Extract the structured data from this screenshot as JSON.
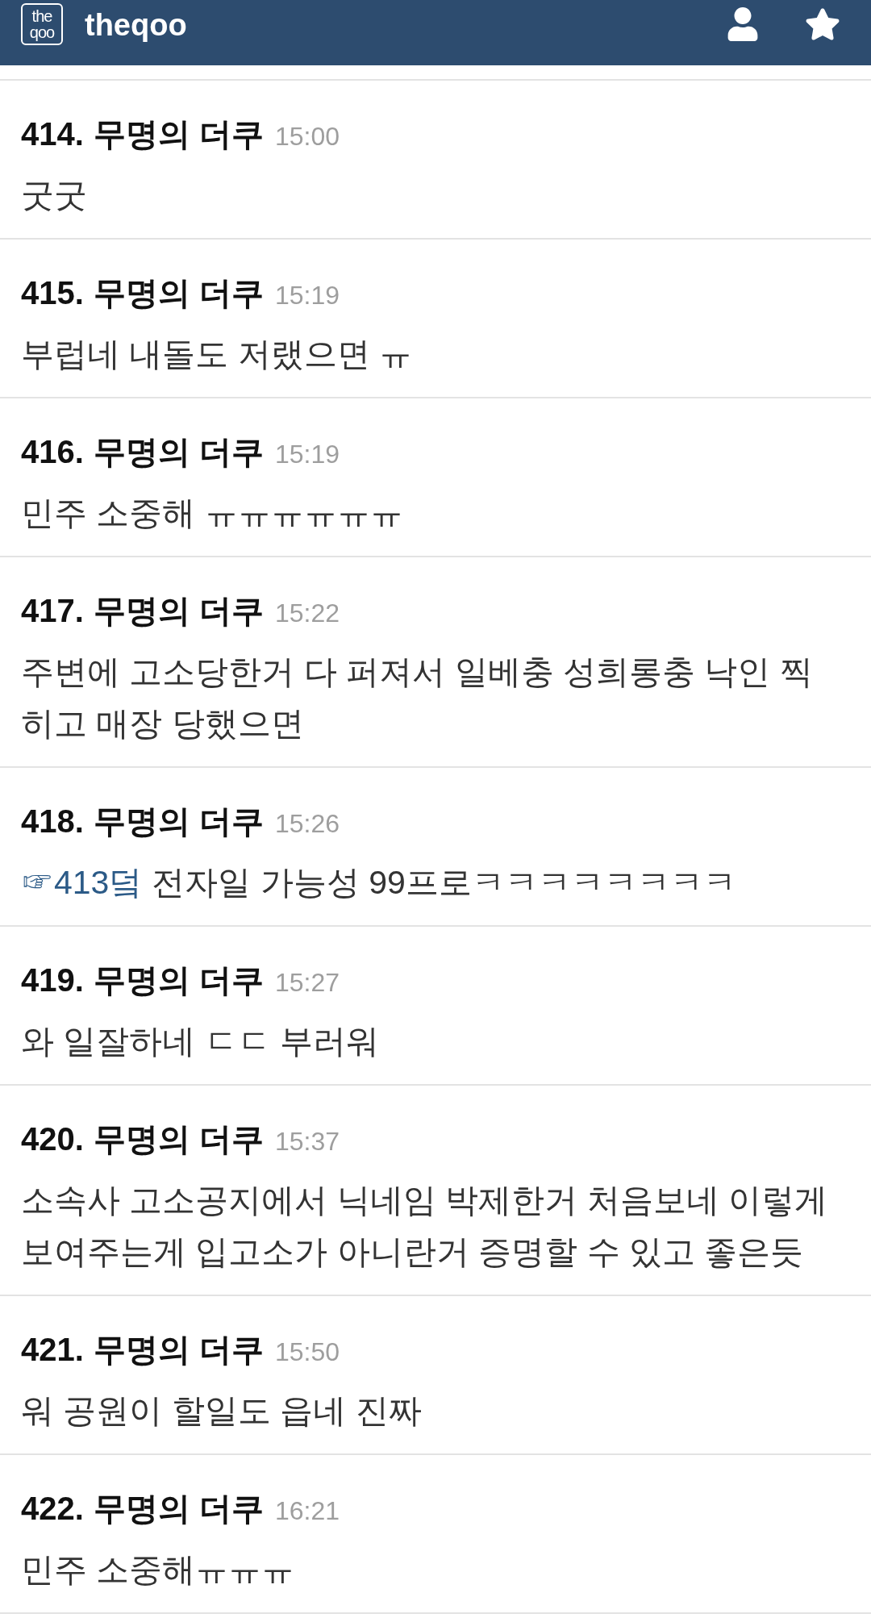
{
  "header": {
    "logo_text": [
      "the",
      "qoo"
    ],
    "site_name": "theqoo"
  },
  "comments": [
    {
      "number": "414.",
      "author": "무명의 더쿠",
      "time": "15:00",
      "text": "굿굿"
    },
    {
      "number": "415.",
      "author": "무명의 더쿠",
      "time": "15:19",
      "text": "부럽네 내돌도 저랬으면 ㅠ"
    },
    {
      "number": "416.",
      "author": "무명의 더쿠",
      "time": "15:19",
      "text": "민주 소중해 ㅠㅠㅠㅠㅠㅠ"
    },
    {
      "number": "417.",
      "author": "무명의 더쿠",
      "time": "15:22",
      "text": "주변에 고소당한거 다 퍼져서 일베충 성희롱충 낙인 찍히고 매장 당했으면"
    },
    {
      "number": "418.",
      "author": "무명의 더쿠",
      "time": "15:26",
      "reply_to": "☞413덬",
      "text": "전자일 가능성 99프로ㅋㅋㅋㅋㅋㅋㅋㅋ"
    },
    {
      "number": "419.",
      "author": "무명의 더쿠",
      "time": "15:27",
      "text": "와 일잘하네 ㄷㄷ 부러워"
    },
    {
      "number": "420.",
      "author": "무명의 더쿠",
      "time": "15:37",
      "text": "소속사 고소공지에서 닉네임 박제한거 처음보네 이렇게 보여주는게 입고소가 아니란거 증명할 수 있고 좋은듯"
    },
    {
      "number": "421.",
      "author": "무명의 더쿠",
      "time": "15:50",
      "text": "워 공원이 할일도 읍네 진짜"
    },
    {
      "number": "422.",
      "author": "무명의 더쿠",
      "time": "16:21",
      "text": "민주 소중해ㅠㅠㅠ"
    }
  ]
}
